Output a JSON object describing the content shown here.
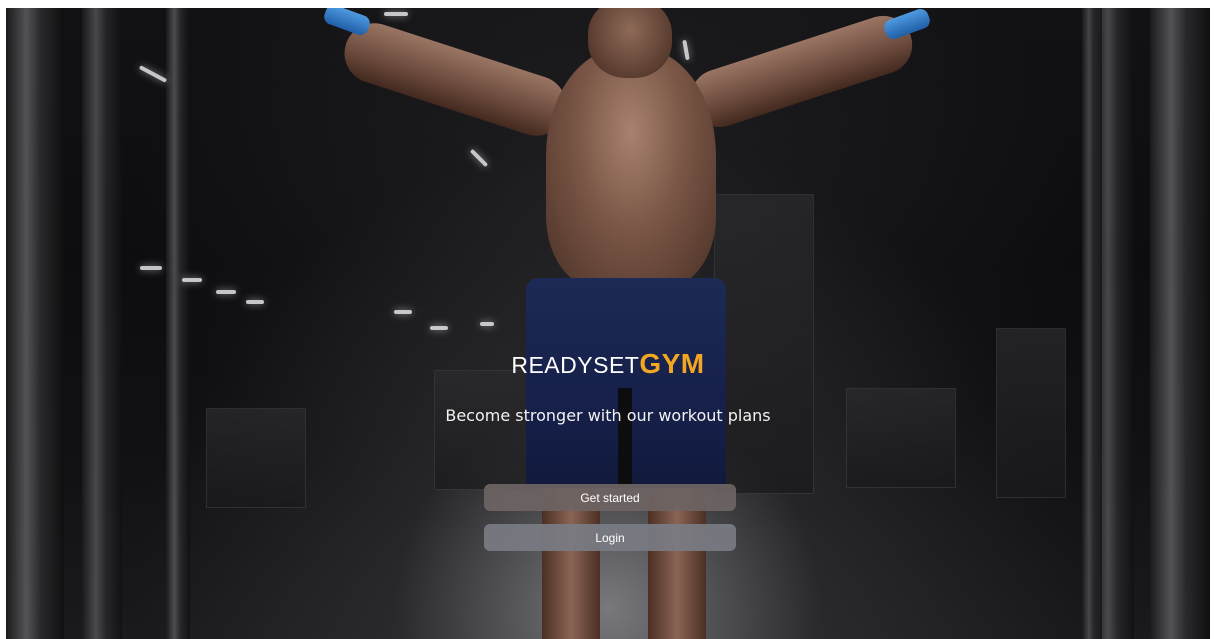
{
  "brand": {
    "name_part1": "READYSET",
    "name_part2": "GYM",
    "accent_color": "#f3a622"
  },
  "hero": {
    "tagline": "Become stronger with our workout plans",
    "background": "gym-athlete-cable-crossover-photo"
  },
  "actions": {
    "get_started_label": "Get started",
    "login_label": "Login"
  },
  "colors": {
    "primary_button": "#6e6464",
    "secondary_button": "#7a7c84",
    "text": "#ffffff"
  }
}
